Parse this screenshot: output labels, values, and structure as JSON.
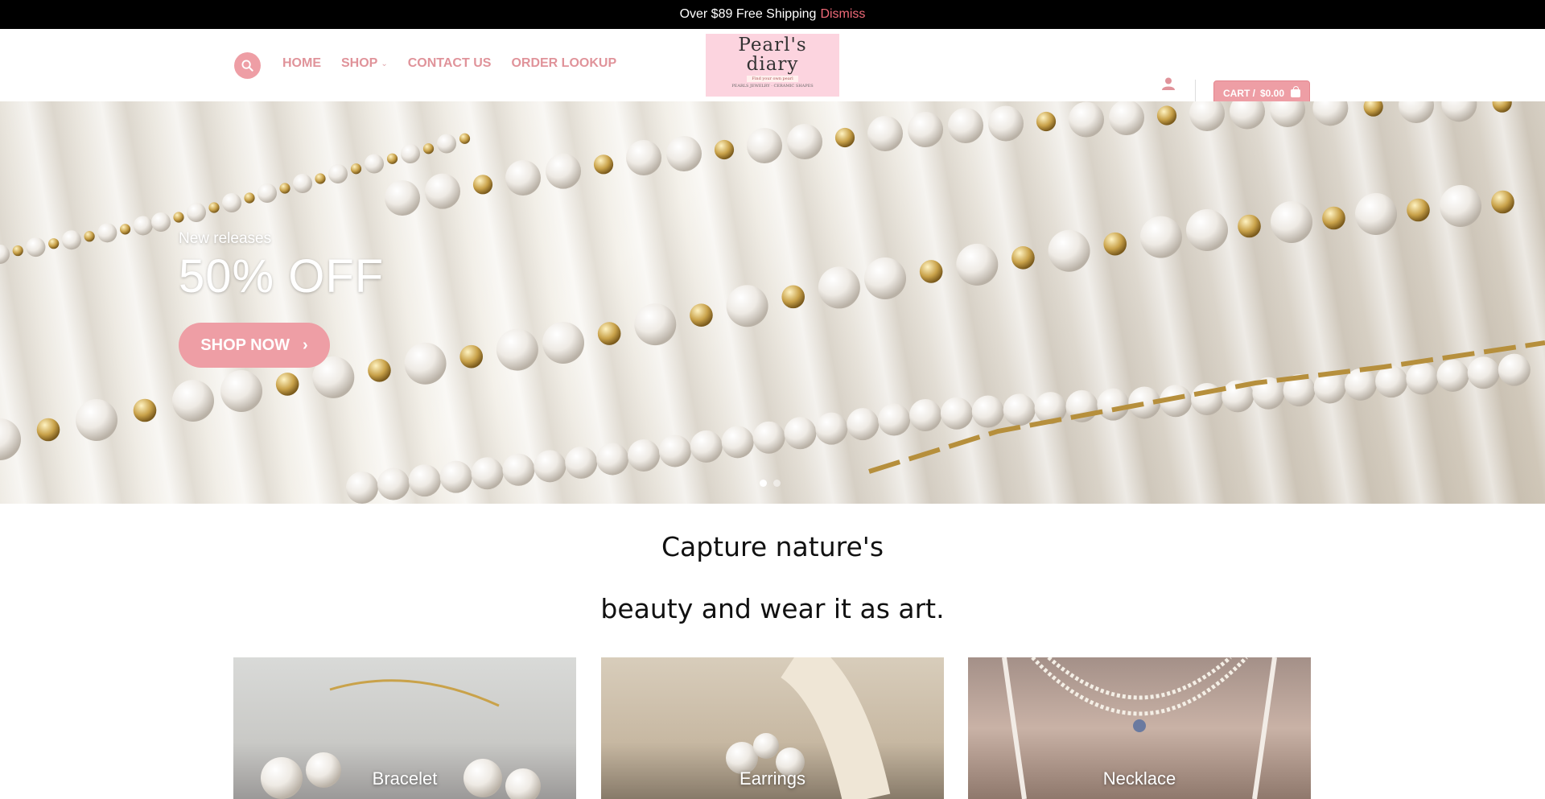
{
  "announcement": {
    "text": "Over $89 Free Shipping",
    "dismiss": "Dismiss"
  },
  "header": {
    "nav": [
      {
        "label": "HOME"
      },
      {
        "label": "SHOP",
        "has_dropdown": true
      },
      {
        "label": "CONTACT US"
      },
      {
        "label": "ORDER LOOKUP"
      }
    ],
    "logo": {
      "line1": "Pearl's",
      "line2": "diary",
      "tagline": "Find your own pearl",
      "subline": "PEARLS JEWELRY · CERAMIC SHAPES"
    },
    "cart": {
      "label": "CART /",
      "amount": "$0.00"
    },
    "icons": {
      "search": "search-icon",
      "account": "user-icon",
      "cart": "shopping-bag-icon"
    }
  },
  "hero": {
    "kicker": "New releases",
    "headline": "50% OFF",
    "cta": "SHOP NOW",
    "slides": 2,
    "active_slide": 1
  },
  "tagline": {
    "line1": "Capture nature's",
    "line2": "beauty and wear it as art."
  },
  "categories": [
    {
      "label": "Bracelet"
    },
    {
      "label": "Earrings"
    },
    {
      "label": "Necklace"
    }
  ],
  "colors": {
    "accent": "#ee9ea5",
    "dismiss": "#f06a78",
    "topbar": "#000000"
  }
}
